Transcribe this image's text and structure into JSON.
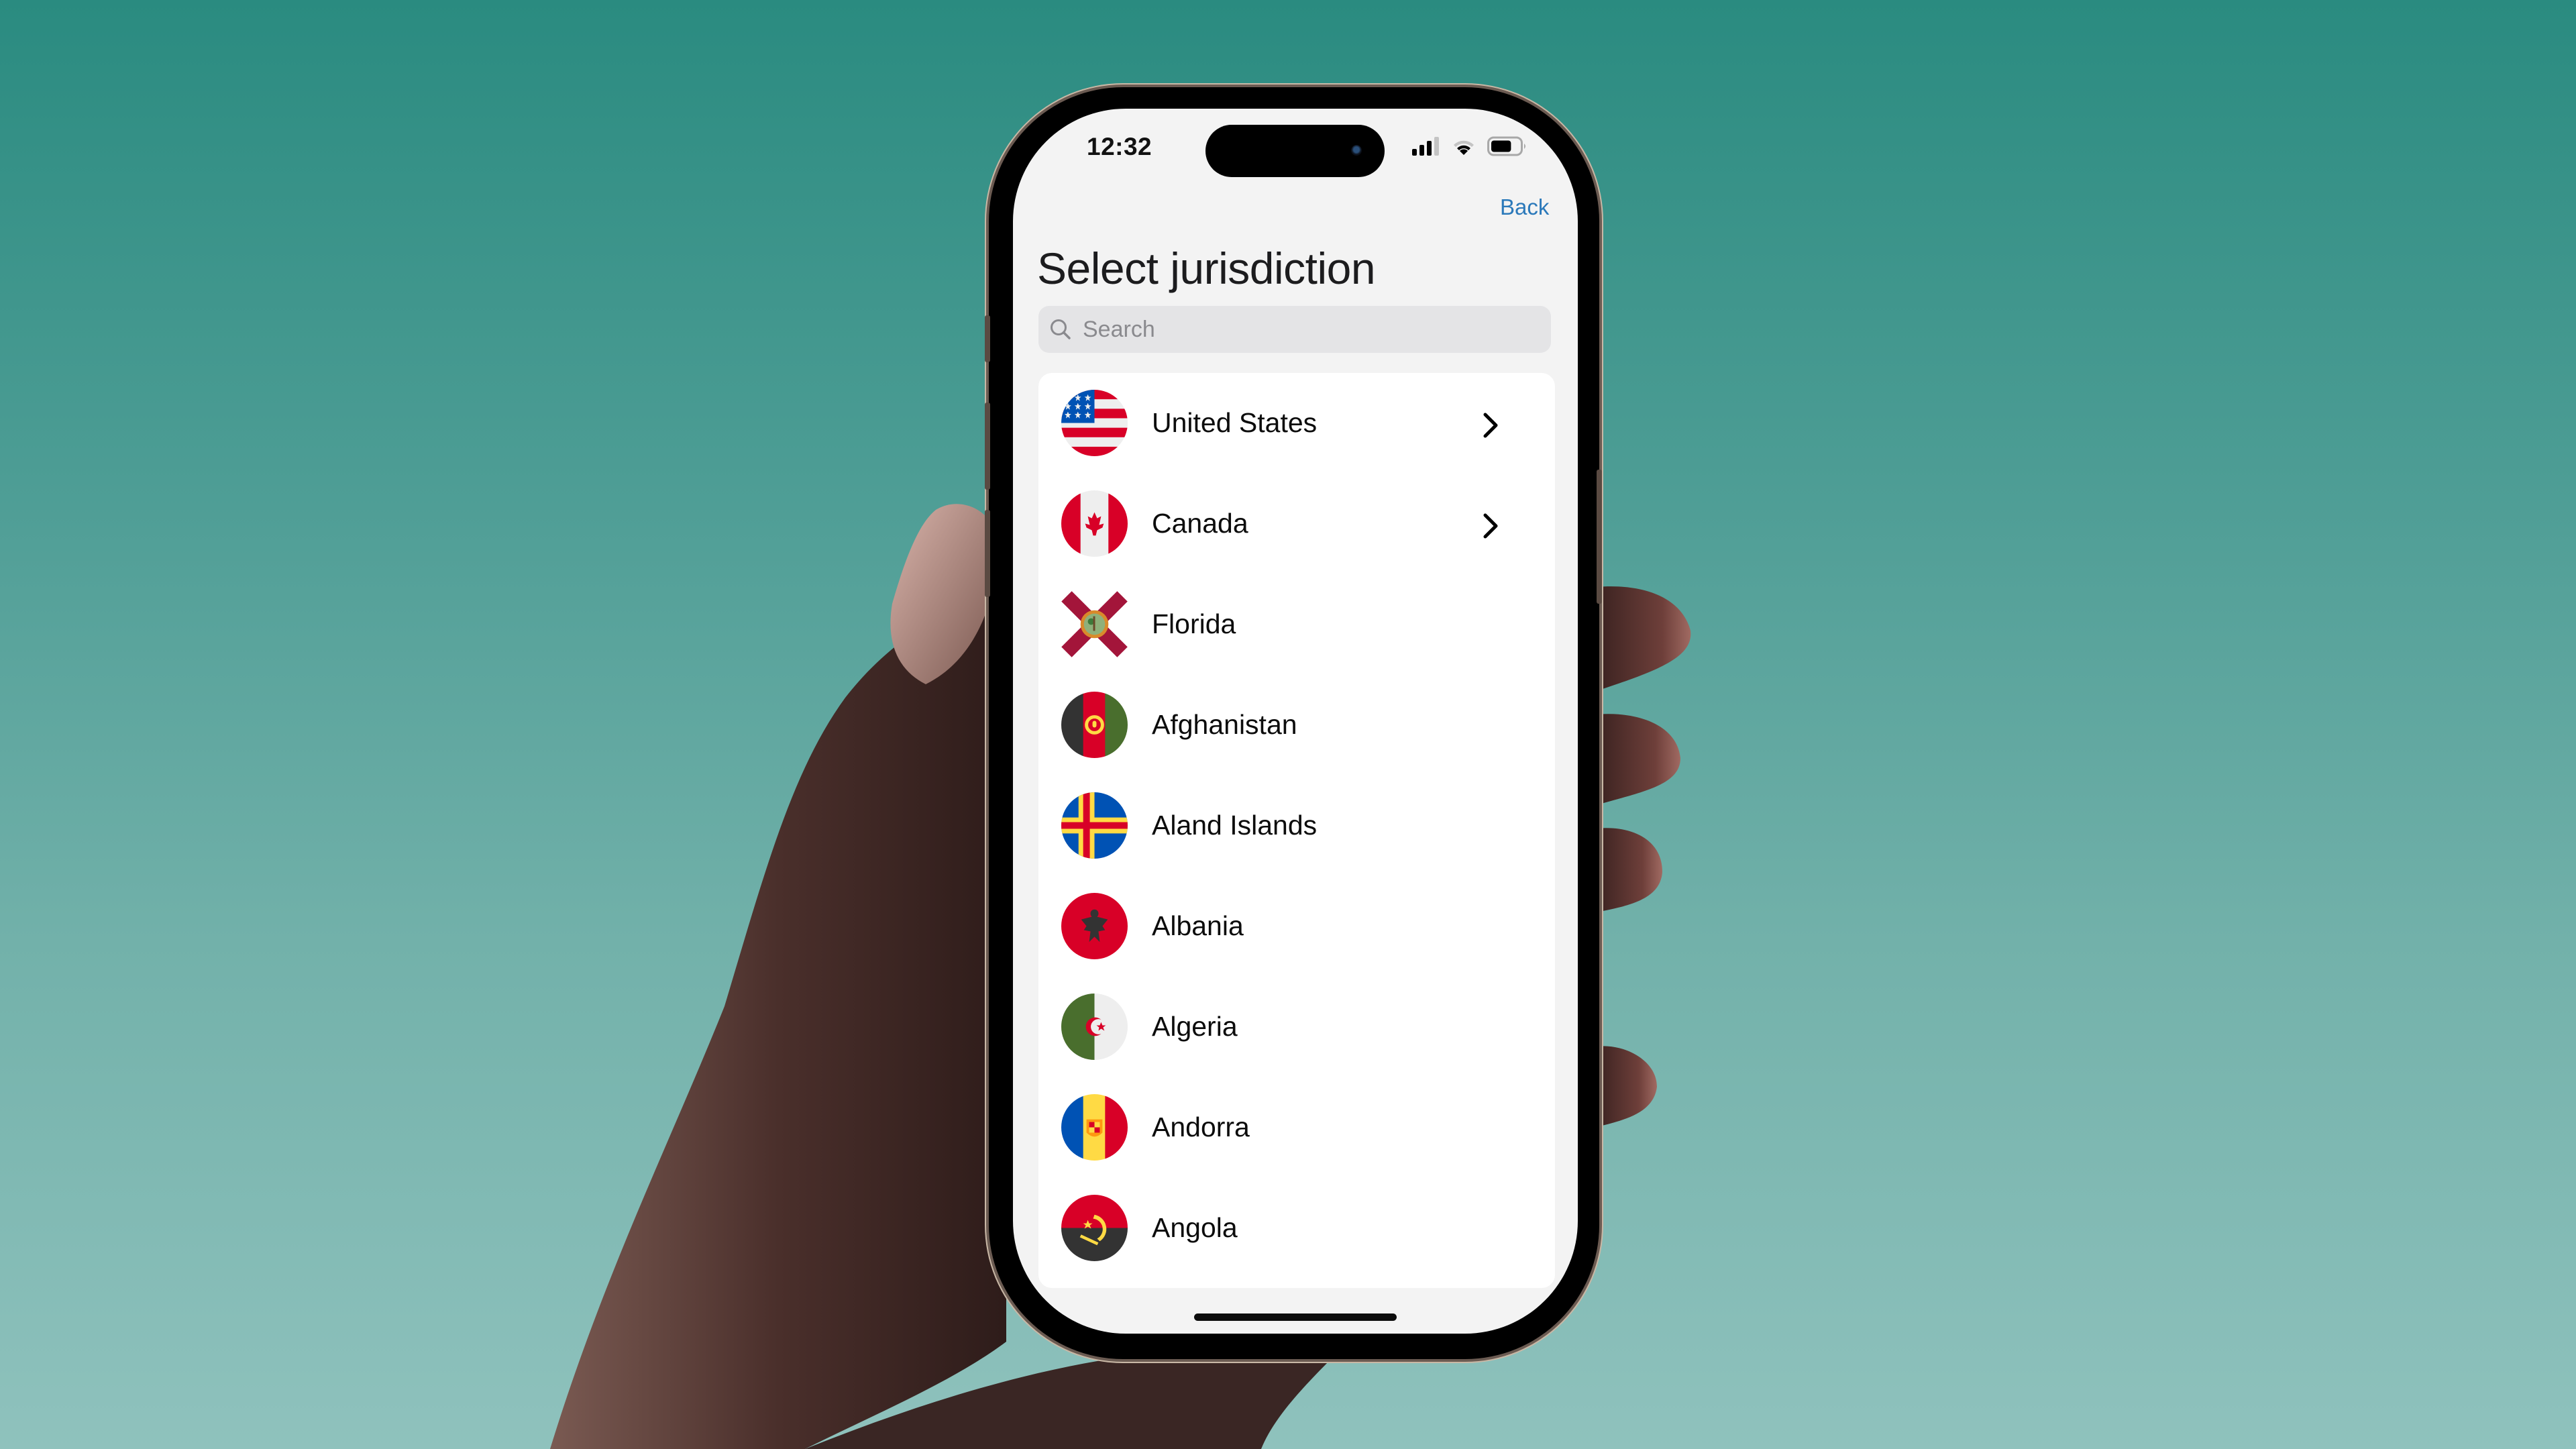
{
  "scene": {
    "background_top": "#2a8b80",
    "background_bottom": "#8fc2bd"
  },
  "status_bar": {
    "time": "12:32",
    "signal_bars_active": 3,
    "signal_bars_total": 4,
    "wifi_arcs_active": 2,
    "wifi_arcs_total": 3,
    "battery_level": 0.7,
    "icons": [
      "signal-icon",
      "wifi-icon",
      "battery-icon"
    ]
  },
  "nav": {
    "back_label": "Back",
    "accent_color": "#2b79ba"
  },
  "page": {
    "title": "Select jurisdiction"
  },
  "search": {
    "placeholder": "Search",
    "value": "",
    "icon": "search-icon"
  },
  "jurisdictions": [
    {
      "name": "United States",
      "flag": "us",
      "has_children": true
    },
    {
      "name": "Canada",
      "flag": "ca",
      "has_children": true
    },
    {
      "name": "Florida",
      "flag": "fl",
      "has_children": false
    },
    {
      "name": "Afghanistan",
      "flag": "af",
      "has_children": false
    },
    {
      "name": "Aland Islands",
      "flag": "ax",
      "has_children": false
    },
    {
      "name": "Albania",
      "flag": "al",
      "has_children": false
    },
    {
      "name": "Algeria",
      "flag": "dz",
      "has_children": false
    },
    {
      "name": "Andorra",
      "flag": "ad",
      "has_children": false
    },
    {
      "name": "Angola",
      "flag": "ao",
      "has_children": false
    }
  ]
}
